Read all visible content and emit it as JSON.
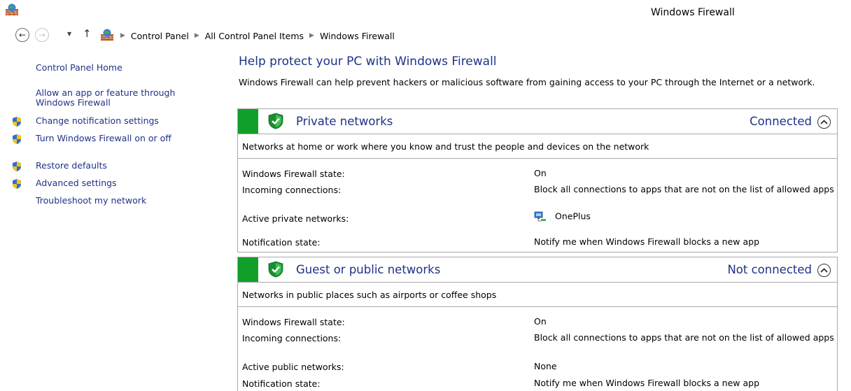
{
  "window": {
    "title": "Windows Firewall"
  },
  "addressbar": {
    "breadcrumbs": [
      "Control Panel",
      "All Control Panel Items",
      "Windows Firewall"
    ]
  },
  "leftnav": {
    "home": "Control Panel Home",
    "allow_app": "Allow an app or feature through Windows Firewall",
    "items": [
      {
        "label": "Change notification settings",
        "icon": "uac-shield-icon"
      },
      {
        "label": "Turn Windows Firewall on or off",
        "icon": "uac-shield-icon"
      },
      {
        "label": "Restore defaults",
        "icon": "uac-shield-icon"
      },
      {
        "label": "Advanced settings",
        "icon": "uac-shield-icon"
      }
    ],
    "troubleshoot": "Troubleshoot my network"
  },
  "main": {
    "title": "Help protect your PC with Windows Firewall",
    "intro": "Windows Firewall can help prevent hackers or malicious software from gaining access to your PC through the Internet or a network.",
    "panels": [
      {
        "title": "Private networks",
        "status": "Connected",
        "description": "Networks at home or work where you know and trust the people and devices on the network",
        "rows": [
          {
            "label": "Windows Firewall state:",
            "value": "On"
          },
          {
            "label": "Incoming connections:",
            "value": "Block all connections to apps that are not on the list of allowed apps"
          },
          {
            "label": "Active private networks:",
            "value": "OnePlus"
          },
          {
            "label": "Notification state:",
            "value": "Notify me when Windows Firewall blocks a new app"
          }
        ]
      },
      {
        "title": "Guest or public networks",
        "status": "Not connected",
        "description": "Networks in public places such as airports or coffee shops",
        "rows": [
          {
            "label": "Windows Firewall state:",
            "value": "On"
          },
          {
            "label": "Incoming connections:",
            "value": "Block all connections to apps that are not on the list of allowed apps"
          },
          {
            "label": "Active public networks:",
            "value": "None"
          },
          {
            "label": "Notification state:",
            "value": "Notify me when Windows Firewall blocks a new app"
          }
        ]
      }
    ]
  },
  "colors": {
    "link": "#1e3287",
    "status_bar": "#10a02a",
    "border": "#a9a9a9"
  }
}
